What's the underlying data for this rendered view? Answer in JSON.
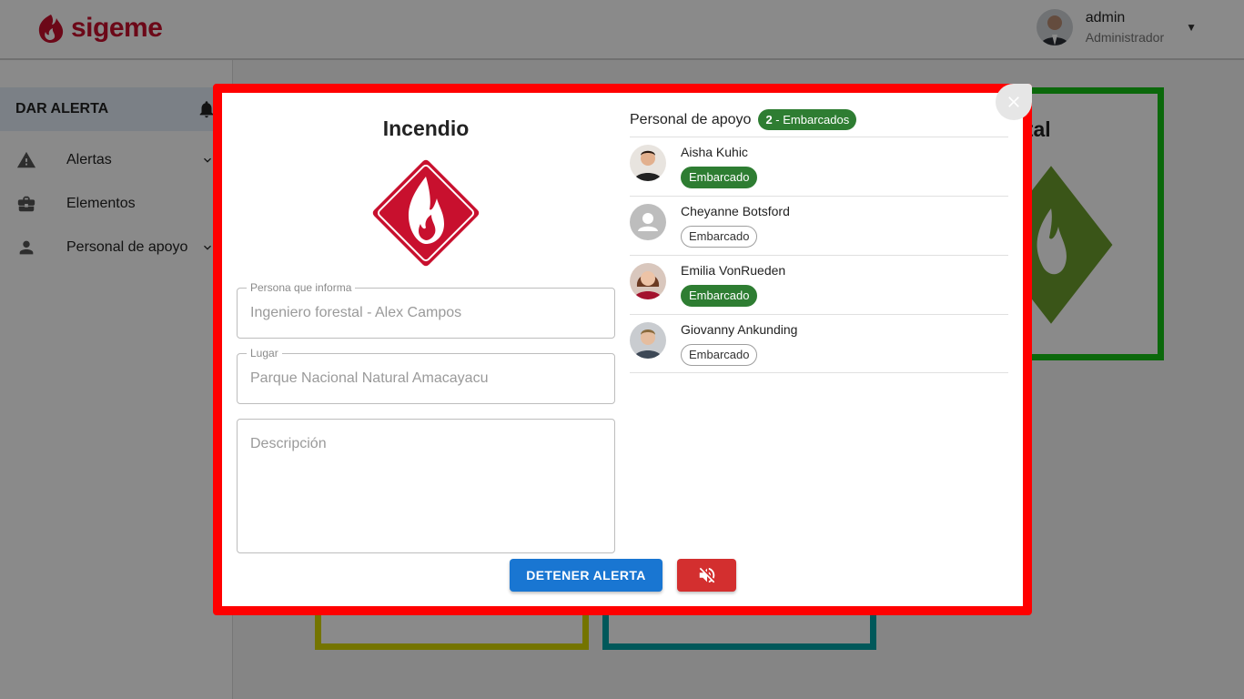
{
  "app": {
    "name": "sigeme"
  },
  "user": {
    "name": "admin",
    "role": "Administrador"
  },
  "sidebar": {
    "alert_button": "DAR ALERTA",
    "items": [
      {
        "label": "Alertas",
        "icon": "warning-icon",
        "expandable": true
      },
      {
        "label": "Elementos",
        "icon": "briefcase-icon",
        "expandable": false
      },
      {
        "label": "Personal de apoyo",
        "icon": "person-icon",
        "expandable": true
      }
    ]
  },
  "background_cards": {
    "partial_title": "stal"
  },
  "modal": {
    "title": "Incendio",
    "reporter": {
      "label": "Persona que informa",
      "value": "Ingeniero forestal - Alex Campos"
    },
    "place": {
      "label": "Lugar",
      "value": "Parque Nacional Natural Amacayacu"
    },
    "description": {
      "placeholder": "Descripción"
    },
    "staff": {
      "title": "Personal de apoyo",
      "count": "2",
      "count_suffix": "- Embarcados",
      "members": [
        {
          "name": "Aisha Kuhic",
          "status": "Embarcado",
          "boarded": true
        },
        {
          "name": "Cheyanne Botsford",
          "status": "Embarcado",
          "boarded": false
        },
        {
          "name": "Emilia VonRueden",
          "status": "Embarcado",
          "boarded": true
        },
        {
          "name": "Giovanny Ankunding",
          "status": "Embarcado",
          "boarded": false
        }
      ]
    },
    "stop_button": "DETENER ALERTA",
    "mute_icon": "volume-off-icon"
  },
  "colors": {
    "brand": "#c8102e",
    "modal_border": "#ff0000",
    "primary": "#1976d2",
    "danger": "#d32f2f",
    "success": "#2e7d32"
  }
}
